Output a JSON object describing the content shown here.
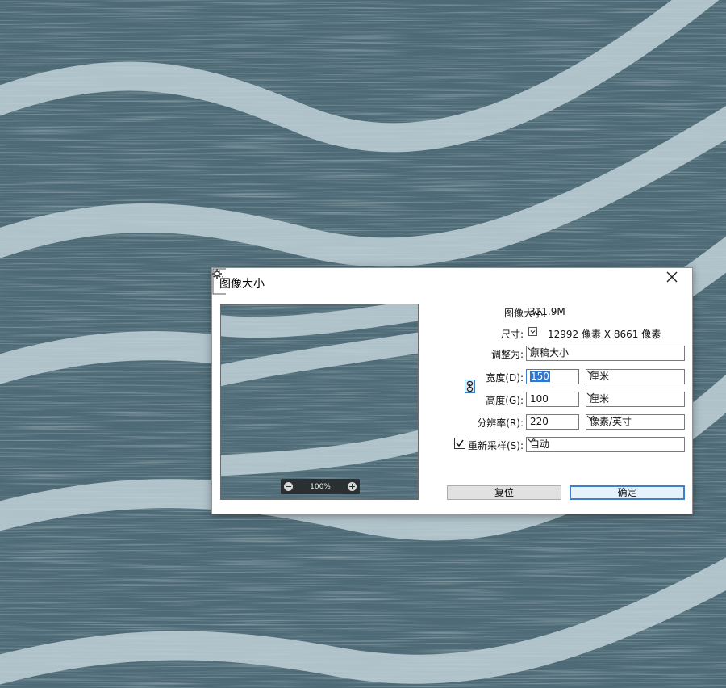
{
  "background": {
    "base_color": "#4d6a76",
    "stripe_color": "#c5d6dc"
  },
  "dialog": {
    "title": "图像大小",
    "close_icon": "close-icon",
    "image_size_label": "图像大小:",
    "image_size_value": "321.9M",
    "gear_icon": "gear-icon",
    "dimensions_label": "尺寸:",
    "dimensions_value": "12992 像素 X 8661 像素",
    "fit_to_label": "调整为:",
    "fit_to_value": "原稿大小",
    "width_label": "宽度(D):",
    "width_value": "150",
    "width_unit": "厘米",
    "height_label": "高度(G):",
    "height_value": "100",
    "height_unit": "厘米",
    "resolution_label": "分辨率(R):",
    "resolution_value": "220",
    "resolution_unit": "像素/英寸",
    "resample_label": "重新采样(S):",
    "resample_checked": true,
    "resample_value": "自动",
    "zoom_level": "100%",
    "reset_button": "复位",
    "ok_button": "确定"
  }
}
